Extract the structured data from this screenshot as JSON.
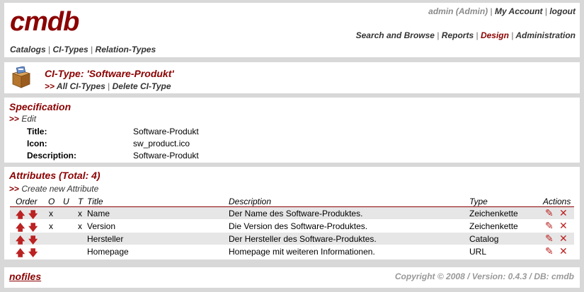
{
  "header": {
    "logo": "cmdb",
    "user_label": "admin (Admin)",
    "my_account": "My Account",
    "logout": "logout",
    "nav": [
      "Search and Browse",
      "Reports",
      "Design",
      "Administration"
    ],
    "nav_active": "Design",
    "subnav": [
      "Catalogs",
      "CI-Types",
      "Relation-Types"
    ]
  },
  "citype": {
    "icon": "box-icon",
    "title": "CI-Type: 'Software-Produkt'",
    "link_prefix": ">>",
    "all_link": "All CI-Types",
    "delete_link": "Delete CI-Type"
  },
  "spec": {
    "title": "Specification",
    "edit_prefix": ">>",
    "edit_label": "Edit",
    "fields": [
      {
        "label": "Title:",
        "value": "Software-Produkt"
      },
      {
        "label": "Icon:",
        "value": "sw_product.ico"
      },
      {
        "label": "Description:",
        "value": "Software-Produkt"
      }
    ]
  },
  "attrs": {
    "title": "Attributes (Total: 4)",
    "create_prefix": ">>",
    "create_label": "Create new Attribute",
    "columns": {
      "order": "Order",
      "o": "O",
      "u": "U",
      "t": "T",
      "title": "Title",
      "description": "Description",
      "type": "Type",
      "actions": "Actions"
    },
    "up_glyph": "🡅",
    "down_glyph": "🡇",
    "edit_glyph": "✎",
    "delete_glyph": "✕",
    "rows": [
      {
        "o": "x",
        "u": "",
        "t": "x",
        "title": "Name",
        "description": "Der Name des Software-Produktes.",
        "type": "Zeichenkette"
      },
      {
        "o": "x",
        "u": "",
        "t": "x",
        "title": "Version",
        "description": "Die Version des Software-Produktes.",
        "type": "Zeichenkette"
      },
      {
        "o": "",
        "u": "",
        "t": "",
        "title": "Hersteller",
        "description": "Der Hersteller des Software-Produktes.",
        "type": "Catalog"
      },
      {
        "o": "",
        "u": "",
        "t": "",
        "title": "Homepage",
        "description": "Homepage mit weiteren Informationen.",
        "type": "URL"
      }
    ]
  },
  "footer": {
    "nofiles": "nofiles",
    "copyright": "Copyright © 2008 / Version: 0.4.3 / DB: cmdb"
  },
  "colors": {
    "accent": "#8b0000",
    "background": "#d8d8d8",
    "row_shade": "#e6e6e6"
  }
}
